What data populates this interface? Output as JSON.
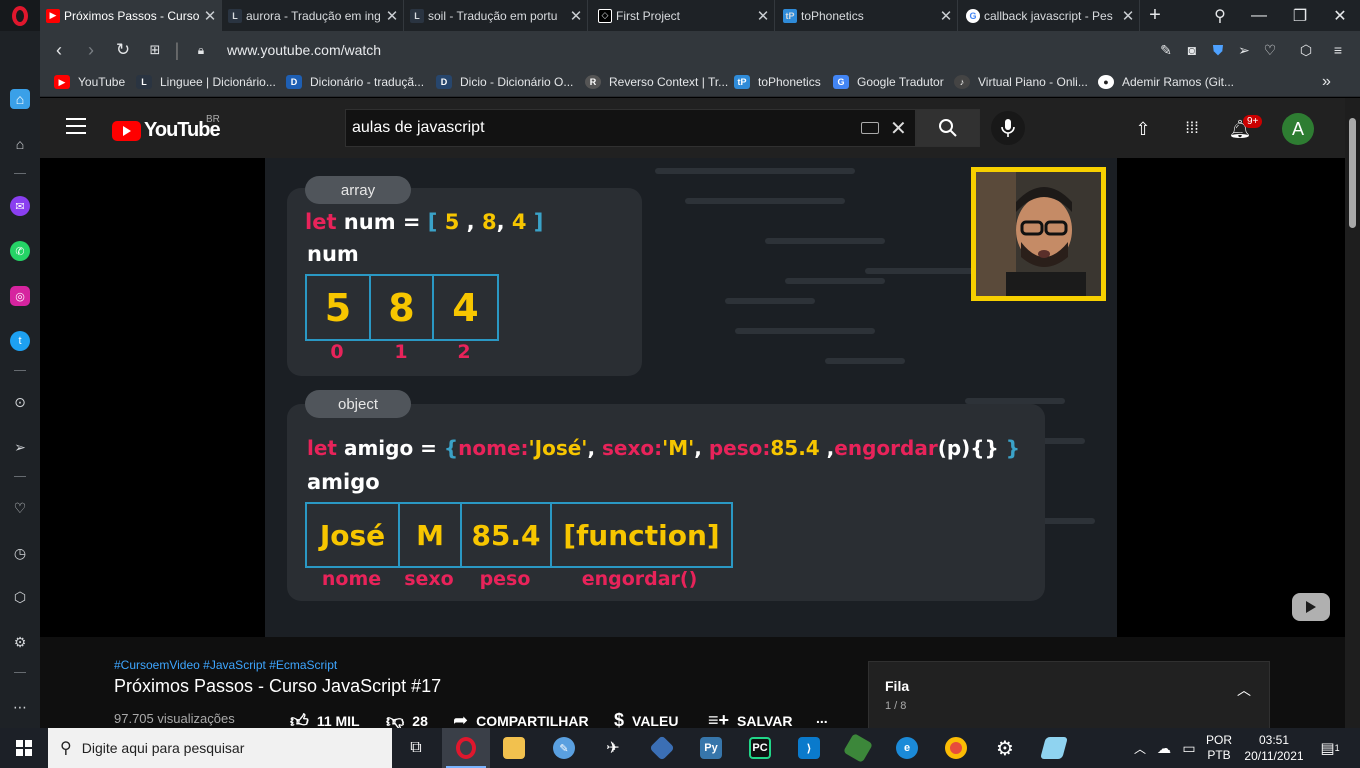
{
  "browser": {
    "tabs": [
      {
        "title": "Próximos Passos - Curso",
        "favicon": "youtube-icon",
        "active": true
      },
      {
        "title": "aurora - Tradução em ing",
        "favicon": "linguee-icon"
      },
      {
        "title": "soil - Tradução em portu",
        "favicon": "linguee-icon"
      },
      {
        "title": "First Project",
        "favicon": "codepen-icon"
      },
      {
        "title": "toPhonetics",
        "favicon": "tophonetics-icon"
      },
      {
        "title": "callback javascript - Pes",
        "favicon": "google-icon"
      }
    ],
    "new_tab": "+",
    "url_host": "www.youtube.com",
    "url_path": "/watch",
    "bookmarks": [
      {
        "label": "YouTube",
        "icon": "youtube-icon",
        "color": "#ff0000"
      },
      {
        "label": "Linguee | Dicionário...",
        "icon": "linguee-icon",
        "color": "#2a3441"
      },
      {
        "label": "Dicionário - traduçã...",
        "icon": "dictionary-icon",
        "color": "#1e5fb4"
      },
      {
        "label": "Dicio - Dicionário O...",
        "icon": "dicio-icon",
        "color": "#27466d"
      },
      {
        "label": "Reverso Context | Tr...",
        "icon": "reverso-icon",
        "color": "#555"
      },
      {
        "label": "toPhonetics",
        "icon": "tophonetics-icon",
        "color": "#2f8bd8"
      },
      {
        "label": "Google Tradutor",
        "icon": "google-translate-icon",
        "color": "#4285f4"
      },
      {
        "label": "Virtual Piano - Onli...",
        "icon": "piano-icon",
        "color": "#444"
      },
      {
        "label": "Ademir Ramos (Git...",
        "icon": "github-icon",
        "color": "#222"
      }
    ],
    "more_bookmarks": "»"
  },
  "youtube": {
    "logo_text": "YouTube",
    "region": "BR",
    "search_value": "aulas de javascript",
    "notification_count": "9+",
    "avatar_letter": "A"
  },
  "video_slide": {
    "array_pill": "array",
    "array_code": {
      "kw": "let",
      "name": " num = ",
      "open": "[ ",
      "v1": "5",
      "c1": " , ",
      "v2": "8",
      "c2": ", ",
      "v3": "4",
      "close": " ]"
    },
    "array_var": "num",
    "array_cells": [
      "5",
      "8",
      "4"
    ],
    "array_indexes": [
      "0",
      "1",
      "2"
    ],
    "object_pill": "object",
    "object_code": {
      "kw": "let",
      "name": " amigo = ",
      "open": "{",
      "k1": "nome:",
      "v1": "'José'",
      "sep1": ", ",
      "k2": "sexo:",
      "v2": "'M'",
      "sep2": ", ",
      "k3": "peso:",
      "v3": "85.4",
      "sep3": " ,",
      "k4": "engordar",
      "v4": "(p){}",
      "close": " }"
    },
    "object_var": "amigo",
    "object_cells": [
      "José",
      "M",
      "85.4",
      "[function]"
    ],
    "object_keys": [
      "nome",
      "sexo",
      "peso",
      "engordar()"
    ]
  },
  "video_info": {
    "hashtags": "#CursoemVideo #JavaScript #EcmaScript",
    "title": "Próximos Passos - Curso JavaScript #17",
    "views": "97.705 visualizações",
    "likes": "11 MIL",
    "dislikes": "28",
    "share": "COMPARTILHAR",
    "thanks": "VALEU",
    "save": "SALVAR",
    "more": "..."
  },
  "queue": {
    "title": "Fila",
    "count": "1 / 8"
  },
  "taskbar": {
    "search_placeholder": "Digite aqui para pesquisar",
    "lang_top": "POR",
    "lang_bottom": "PTB",
    "time": "03:51",
    "date": "20/11/2021",
    "notif_count": "1"
  }
}
